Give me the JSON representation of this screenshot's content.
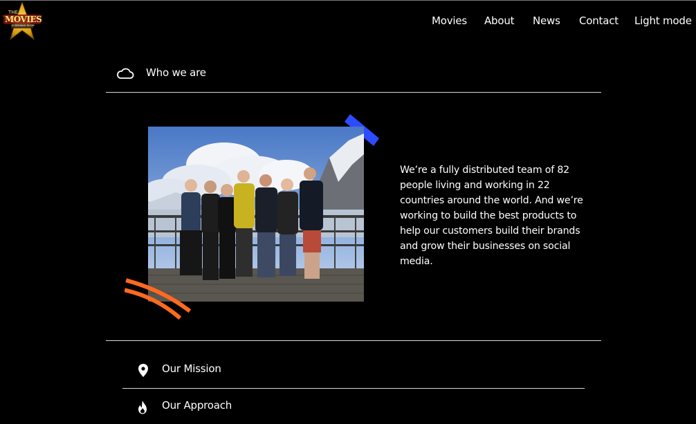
{
  "header": {
    "logo_text_top": "THE",
    "logo_text_main": "MOVIES",
    "logo_text_sub": "SCREENING ROOM",
    "nav": [
      {
        "label": "Movies"
      },
      {
        "label": "About"
      },
      {
        "label": "News"
      },
      {
        "label": "Contact"
      },
      {
        "label": "Light mode"
      }
    ]
  },
  "who": {
    "title": "Who we are",
    "icon": "cloud-icon",
    "description": "We’re a fully distributed team of 82 people living and working in 22 countries around the world. And we’re working to build the best products to help our customers build their brands and grow their businesses on social media."
  },
  "accordion": [
    {
      "label": "Our Mission",
      "icon": "location-pin-icon"
    },
    {
      "label": "Our Approach",
      "icon": "flame-icon"
    }
  ],
  "colors": {
    "background": "#000000",
    "tape_blue": "#2e4bff",
    "stroke_orange": "#ff6a1f"
  }
}
